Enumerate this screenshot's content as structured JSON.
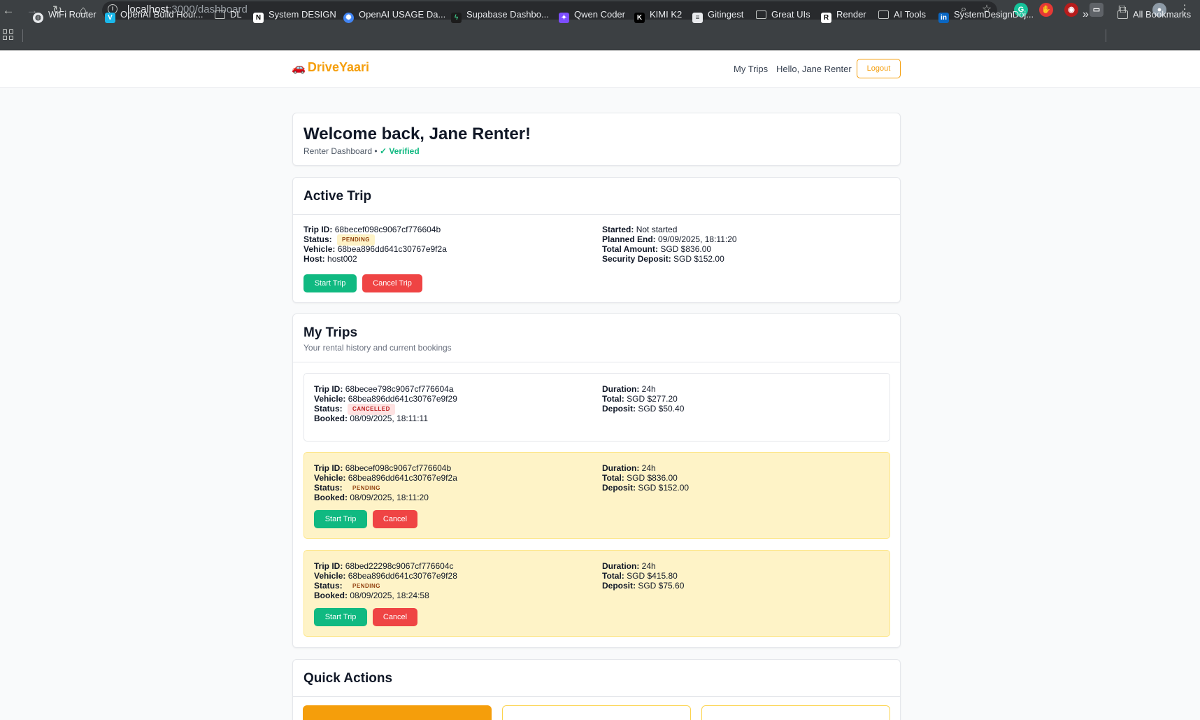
{
  "browser": {
    "url_host": "localhost",
    "url_path": ":3000/dashboard",
    "bookmarks": [
      {
        "label": "WiFi Router",
        "icon": "globe-icon"
      },
      {
        "label": "OpenAI Build Hour...",
        "icon": "vimeo-icon"
      },
      {
        "label": "DL",
        "icon": "folder-icon"
      },
      {
        "label": "System DESIGN",
        "icon": "notion-icon"
      },
      {
        "label": "OpenAI USAGE Da...",
        "icon": "openai-icon"
      },
      {
        "label": "Supabase Dashbo...",
        "icon": "supabase-icon"
      },
      {
        "label": "Qwen Coder",
        "icon": "qwen-icon"
      },
      {
        "label": "KIMI K2",
        "icon": "kimi-icon"
      },
      {
        "label": "Gitingest",
        "icon": "gitingest-icon"
      },
      {
        "label": "Great UIs",
        "icon": "folder-icon"
      },
      {
        "label": "Render",
        "icon": "render-icon"
      },
      {
        "label": "AI Tools",
        "icon": "folder-icon"
      },
      {
        "label": "SystemDesignDoj...",
        "icon": "linkedin-icon"
      }
    ],
    "all_bookmarks": "All Bookmarks"
  },
  "header": {
    "brand": "DriveYaari",
    "nav_my_trips": "My Trips",
    "greeting": "Hello, Jane Renter",
    "logout": "Logout"
  },
  "welcome": {
    "title": "Welcome back, Jane Renter!",
    "subtitle": "Renter Dashboard •",
    "verified": "✓ Verified"
  },
  "active_trip": {
    "title": "Active Trip",
    "trip_id_label": "Trip ID:",
    "trip_id": "68becef098c9067cf776604b",
    "status_label": "Status:",
    "status": "PENDING",
    "vehicle_label": "Vehicle:",
    "vehicle": "68bea896dd641c30767e9f2a",
    "host_label": "Host:",
    "host": "host002",
    "started_label": "Started:",
    "started": "Not started",
    "planned_end_label": "Planned End:",
    "planned_end": "09/09/2025, 18:11:20",
    "total_label": "Total Amount:",
    "total": "SGD $836.00",
    "deposit_label": "Security Deposit:",
    "deposit": "SGD $152.00",
    "start_button": "Start Trip",
    "cancel_button": "Cancel Trip"
  },
  "my_trips": {
    "title": "My Trips",
    "subtitle": "Your rental history and current bookings",
    "labels": {
      "trip_id": "Trip ID:",
      "vehicle": "Vehicle:",
      "status": "Status:",
      "booked": "Booked:",
      "duration": "Duration:",
      "total": "Total:",
      "deposit": "Deposit:",
      "start": "Start Trip",
      "cancel": "Cancel"
    },
    "trips": [
      {
        "trip_id": "68becee798c9067cf776604a",
        "vehicle": "68bea896dd641c30767e9f29",
        "status": "CANCELLED",
        "booked": "08/09/2025, 18:11:11",
        "duration": "24h",
        "total": "SGD $277.20",
        "deposit": "SGD $50.40"
      },
      {
        "trip_id": "68becef098c9067cf776604b",
        "vehicle": "68bea896dd641c30767e9f2a",
        "status": "PENDING",
        "booked": "08/09/2025, 18:11:20",
        "duration": "24h",
        "total": "SGD $836.00",
        "deposit": "SGD $152.00"
      },
      {
        "trip_id": "68bed22298c9067cf776604c",
        "vehicle": "68bea896dd641c30767e9f28",
        "status": "PENDING",
        "booked": "08/09/2025, 18:24:58",
        "duration": "24h",
        "total": "SGD $415.80",
        "deposit": "SGD $75.60"
      }
    ]
  },
  "quick_actions": {
    "title": "Quick Actions"
  },
  "colors": {
    "brand": "#f59e0b",
    "success": "#10b981",
    "danger": "#ef4444",
    "pending_bg": "#fef3c7"
  }
}
